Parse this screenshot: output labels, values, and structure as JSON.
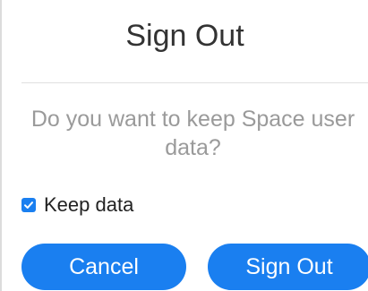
{
  "dialog": {
    "title": "Sign Out",
    "message": "Do you want to keep Space user data?",
    "keep_data": {
      "label": "Keep data",
      "checked": true
    },
    "buttons": {
      "cancel_label": "Cancel",
      "sign_out_label": "Sign Out"
    }
  },
  "colors": {
    "accent": "#1a7ff0",
    "title_text": "#333333",
    "message_text": "#9a9a9a",
    "button_text": "#ffffff"
  },
  "icons": {
    "checkbox": "checkmark-icon"
  }
}
